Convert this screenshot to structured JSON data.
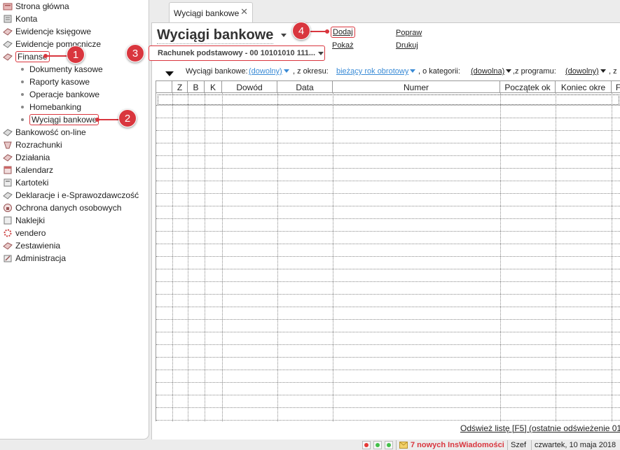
{
  "sidebar": {
    "items": [
      {
        "label": "Strona główna",
        "icon": "home-icon"
      },
      {
        "label": "Konta",
        "icon": "accounts-icon"
      },
      {
        "label": "Ewidencje księgowe",
        "icon": "ledger-icon"
      },
      {
        "label": "Ewidencje pomocnicze",
        "icon": "aux-ledger-icon"
      },
      {
        "label": "Finanse",
        "icon": "finance-icon"
      },
      {
        "label": "Bankowość on-line",
        "icon": "online-banking-icon"
      },
      {
        "label": "Rozrachunki",
        "icon": "settlements-icon"
      },
      {
        "label": "Działania",
        "icon": "actions-icon"
      },
      {
        "label": "Kalendarz",
        "icon": "calendar-icon"
      },
      {
        "label": "Kartoteki",
        "icon": "records-icon"
      },
      {
        "label": "Deklaracje i e-Sprawozdawczość",
        "icon": "declarations-icon"
      },
      {
        "label": "Ochrona danych osobowych",
        "icon": "privacy-icon"
      },
      {
        "label": "Naklejki",
        "icon": "stickers-icon"
      },
      {
        "label": "vendero",
        "icon": "vendero-icon"
      },
      {
        "label": "Zestawienia",
        "icon": "reports-icon"
      },
      {
        "label": "Administracja",
        "icon": "admin-icon"
      }
    ],
    "finance_sub": [
      {
        "label": "Dokumenty kasowe"
      },
      {
        "label": "Raporty kasowe"
      },
      {
        "label": "Operacje bankowe"
      },
      {
        "label": "Homebanking"
      },
      {
        "label": "Wyciągi bankowe"
      }
    ]
  },
  "badges": [
    "1",
    "2",
    "3",
    "4"
  ],
  "tab": {
    "label": "Wyciągi bankowe",
    "close": "✕"
  },
  "main": {
    "title": "Wyciągi bankowe",
    "account": "Rachunek podstawowy - 00 10101010 111...",
    "actions": {
      "add": "Dodaj",
      "show": "Pokaż",
      "edit": "Popraw",
      "print": "Drukuj"
    }
  },
  "filters": {
    "statements_label": "Wyciągi bankowe:",
    "statements_value": "(dowolny)",
    "period_label": ", z okresu:",
    "period_value": "bieżący rok obrotowy",
    "category_label": ", o kategorii:",
    "category_value": "(dowolna)",
    "program_label": ",z programu:",
    "program_value": "(dowolny)",
    "more_label": ", z"
  },
  "grid": {
    "columns": [
      "",
      "Z",
      "B",
      "K",
      "Dowód",
      "Data",
      "Numer",
      "Początek ok",
      "Koniec okre",
      "F"
    ],
    "row_count": 26
  },
  "refresh": "Odśwież listę [F5] (ostatnie odświeżenie 01:0",
  "statusbar": {
    "messages": "7 nowych InsWiadomości",
    "user": "Szef",
    "date": "czwartek, 10 maja 2018"
  },
  "colors": {
    "accent": "#d9363e",
    "link": "#3a8bd6"
  }
}
